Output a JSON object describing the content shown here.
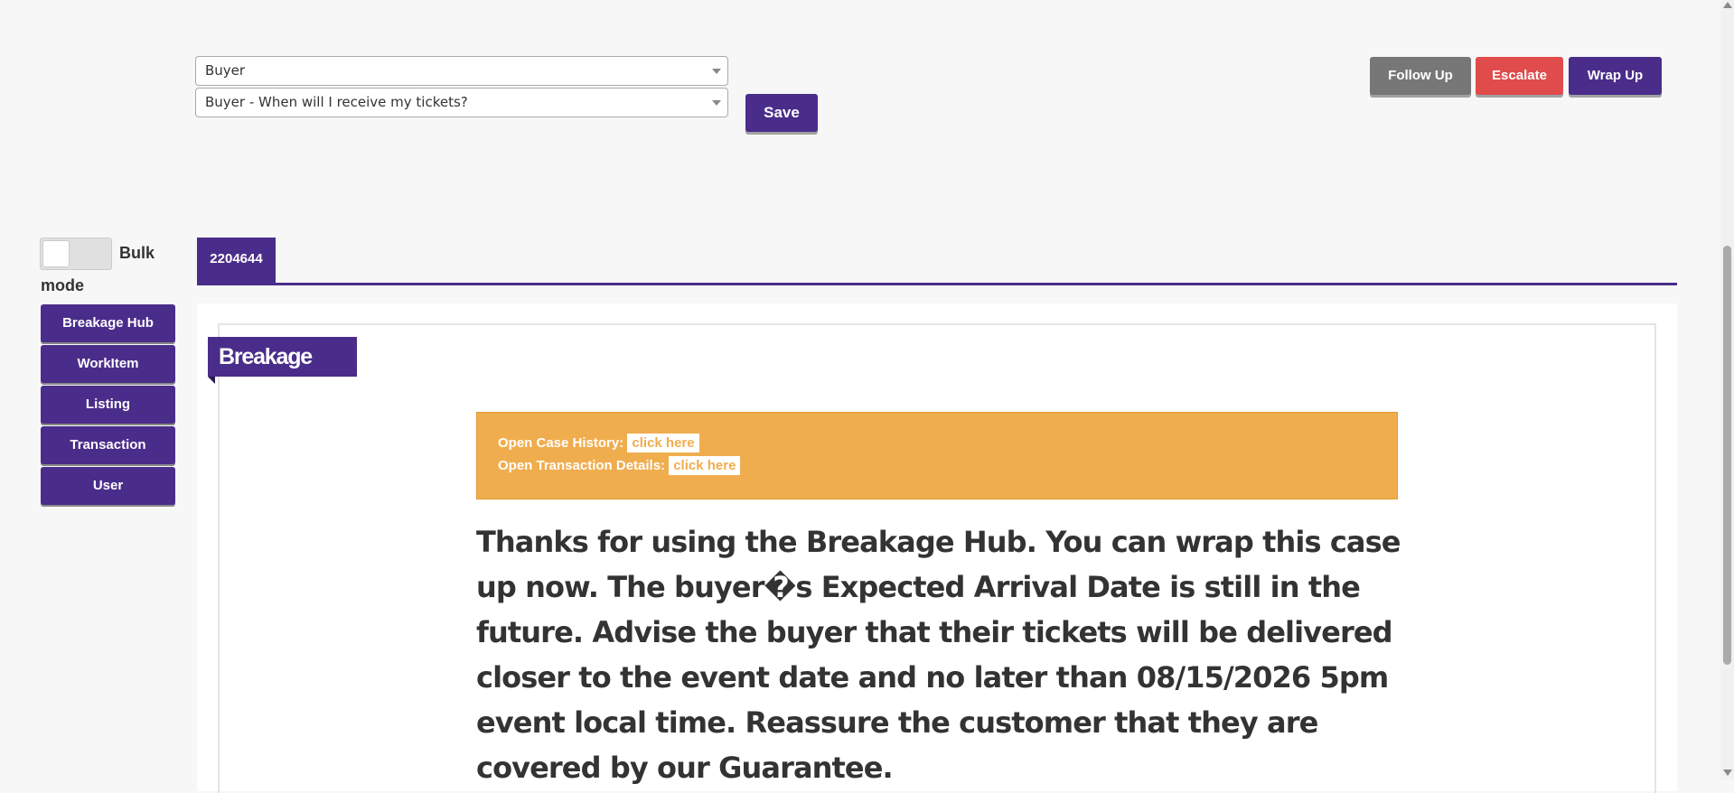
{
  "form": {
    "category_select": "Buyer",
    "reason_select": "Buyer - When will I receive my tickets?",
    "save_label": "Save"
  },
  "actions": {
    "follow_up": "Follow Up",
    "escalate": "Escalate",
    "wrap_up": "Wrap Up"
  },
  "bulk_mode": {
    "label_part1": "Bulk",
    "label_part2": "mode",
    "enabled": false
  },
  "sidebar": {
    "items": [
      {
        "label": "Breakage Hub"
      },
      {
        "label": "WorkItem"
      },
      {
        "label": "Listing"
      },
      {
        "label": "Transaction"
      },
      {
        "label": "User"
      }
    ]
  },
  "tabs": [
    {
      "label": "2204644"
    }
  ],
  "panel": {
    "title": "Breakage Hub",
    "alert": {
      "case_history_label": "Open Case History:",
      "case_history_link": "click here",
      "transaction_label": "Open Transaction Details:",
      "transaction_link": "click here"
    },
    "message": "Thanks for using the Breakage Hub. You can wrap this case up now. The buyer�s Expected Arrival Date is still in the future. Advise the buyer that their tickets will be delivered closer to the event date and no later than 08/15/2026 5pm event local time. Reassure the customer that they are covered by our Guarantee."
  },
  "colors": {
    "primary": "#4a2d8a",
    "danger": "#e04b4b",
    "secondary": "#777777",
    "warning": "#f0ad4e"
  }
}
